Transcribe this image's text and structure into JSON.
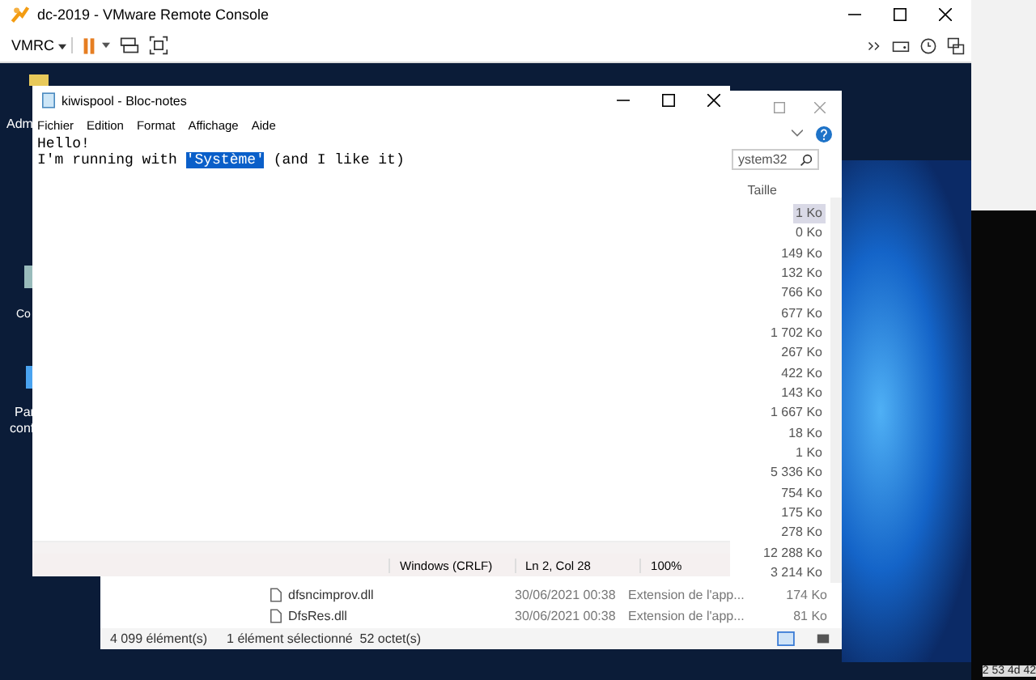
{
  "vmrc": {
    "title": "dc-2019 - VMware Remote Console",
    "menu_label": "VMRC"
  },
  "desktop_icons": [
    {
      "label": "Adm"
    },
    {
      "label": "Co"
    },
    {
      "label": "Par",
      "label_2": "conf"
    }
  ],
  "explorer": {
    "search_value": "ystem32",
    "column_header": "Taille",
    "sizes": [
      {
        "text": "1 Ko",
        "selected": true
      },
      {
        "text": "0 Ko",
        "selected": false
      },
      {
        "text": "149 Ko",
        "selected": false
      },
      {
        "text": "132 Ko",
        "selected": false
      },
      {
        "text": "766 Ko",
        "selected": false
      },
      {
        "text": "677 Ko",
        "selected": false
      },
      {
        "text": "1 702 Ko",
        "selected": false
      },
      {
        "text": "267 Ko",
        "selected": false
      },
      {
        "text": "422 Ko",
        "selected": false
      },
      {
        "text": "143 Ko",
        "selected": false
      },
      {
        "text": "1 667 Ko",
        "selected": false
      },
      {
        "text": "18 Ko",
        "selected": false
      },
      {
        "text": "1 Ko",
        "selected": false
      },
      {
        "text": "5 336 Ko",
        "selected": false
      },
      {
        "text": "754 Ko",
        "selected": false
      },
      {
        "text": "175 Ko",
        "selected": false
      },
      {
        "text": "278 Ko",
        "selected": false
      },
      {
        "text": "12 288 Ko",
        "selected": false
      },
      {
        "text": "3 214 Ko",
        "selected": false
      }
    ],
    "rows": [
      {
        "name": "dfsncimprov.dll",
        "date": "30/06/2021 00:38",
        "type": "Extension de l'app...",
        "size": "174 Ko"
      },
      {
        "name": "DfsRes.dll",
        "date": "30/06/2021 00:38",
        "type": "Extension de l'app...",
        "size": "81 Ko"
      }
    ],
    "status_count": "4 099 élément(s)",
    "status_selection": "1 élément sélectionné  52 octet(s)"
  },
  "notepad": {
    "title": "kiwispool - Bloc-notes",
    "menu": [
      "Fichier",
      "Edition",
      "Format",
      "Affichage",
      "Aide"
    ],
    "lines": [
      {
        "text": "Hello!"
      },
      {
        "before": "I'm running with ",
        "highlight": "'Système'",
        "after": " (and I like it)"
      }
    ],
    "status": [
      "Windows (CRLF)",
      "Ln 2, Col 28",
      "100%"
    ]
  },
  "console_text": "2 53 4d 42"
}
